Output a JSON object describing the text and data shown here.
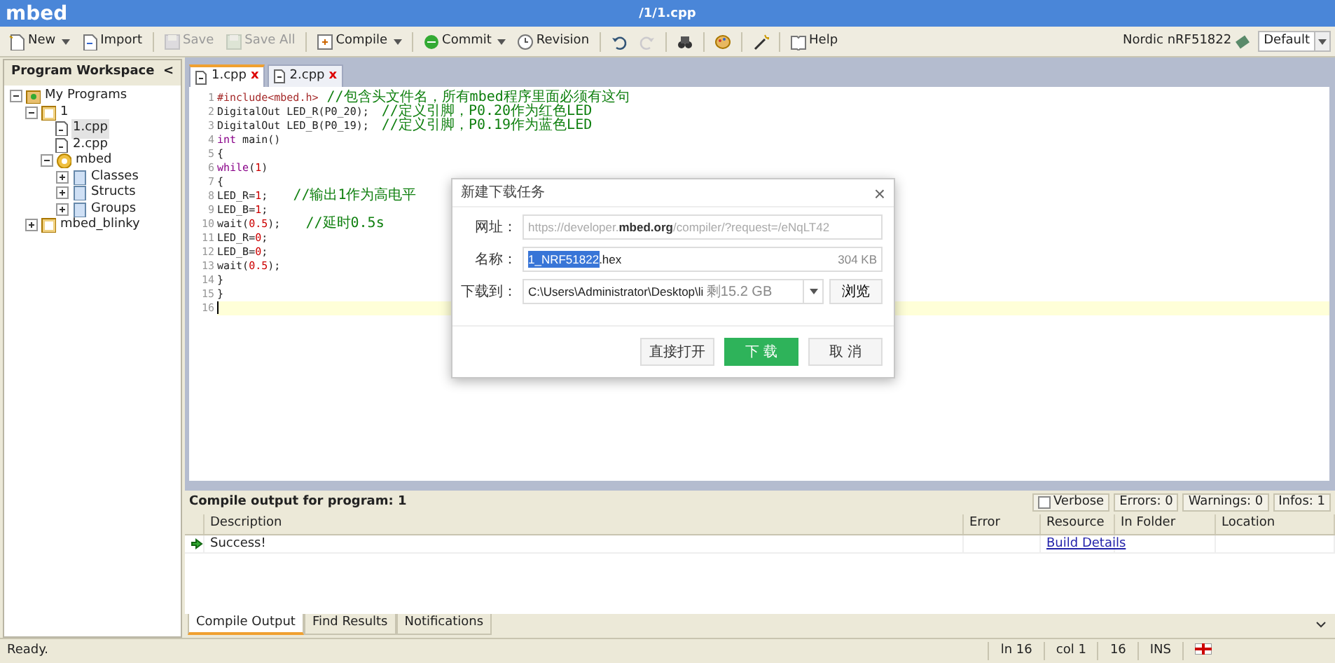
{
  "window": {
    "title": "mbed",
    "path": "/1/1.cpp"
  },
  "toolbar": [
    {
      "kind": "new",
      "label": "New",
      "dropdown": true,
      "disabled": false
    },
    {
      "kind": "import",
      "label": "Import",
      "dropdown": false,
      "disabled": false
    },
    {
      "kind": "save",
      "label": "Save",
      "dropdown": false,
      "disabled": true
    },
    {
      "kind": "saveall",
      "label": "Save All",
      "dropdown": false,
      "disabled": true
    },
    {
      "kind": "compile",
      "label": "Compile",
      "dropdown": true,
      "disabled": false
    },
    {
      "kind": "commit",
      "label": "Commit",
      "dropdown": true,
      "disabled": false
    },
    {
      "kind": "revision",
      "label": "Revision",
      "dropdown": false,
      "disabled": false
    },
    {
      "kind": "undo",
      "dropdown": false,
      "disabled": false
    },
    {
      "kind": "redo",
      "dropdown": false,
      "disabled": true
    },
    {
      "kind": "find",
      "dropdown": false,
      "disabled": false
    },
    {
      "kind": "palette",
      "dropdown": false,
      "disabled": false
    },
    {
      "kind": "wand",
      "dropdown": false,
      "disabled": false
    },
    {
      "kind": "help",
      "label": "Help",
      "dropdown": false,
      "disabled": false
    }
  ],
  "platform": {
    "label": "Nordic nRF51822",
    "theme": "Default"
  },
  "sidebar": {
    "title": "Program Workspace",
    "collapse": "<",
    "items": [
      {
        "label": "My Programs",
        "kind": "workspace",
        "expanded": true,
        "selected": false,
        "children": [
          {
            "label": "1",
            "kind": "program",
            "expanded": true,
            "selected": false,
            "children": [
              {
                "label": "1.cpp",
                "kind": "file",
                "selected": true
              },
              {
                "label": "2.cpp",
                "kind": "file",
                "selected": false
              },
              {
                "label": "mbed",
                "kind": "library",
                "expanded": true,
                "selected": false,
                "children": [
                  {
                    "label": "Classes",
                    "kind": "docs",
                    "expanded": false,
                    "selected": false
                  },
                  {
                    "label": "Structs",
                    "kind": "docs",
                    "expanded": false,
                    "selected": false
                  },
                  {
                    "label": "Groups",
                    "kind": "docs",
                    "expanded": false,
                    "selected": false
                  }
                ]
              }
            ]
          },
          {
            "label": "mbed_blinky",
            "kind": "program",
            "expanded": false,
            "selected": false
          }
        ]
      }
    ]
  },
  "tabs": [
    {
      "label": "1.cpp",
      "selected": true,
      "close": "x"
    },
    {
      "label": "2.cpp",
      "selected": false,
      "close": "x"
    }
  ],
  "code": [
    {
      "number": "1",
      "current": false,
      "segments": [
        {
          "kind": "pre",
          "text": "#include<mbed.h>"
        },
        {
          "kind": "comment",
          "text": " //包含头文件名，所有mbed程序里面必须有这句"
        }
      ]
    },
    {
      "number": "2",
      "current": false,
      "segments": [
        {
          "kind": "plain",
          "text": "DigitalOut LED_R(P0_20);  "
        },
        {
          "kind": "comment",
          "text": "//定义引脚，P0.20作为红色LED"
        }
      ]
    },
    {
      "number": "3",
      "current": false,
      "segments": [
        {
          "kind": "plain",
          "text": "DigitalOut LED_B(P0_19);  "
        },
        {
          "kind": "comment",
          "text": "//定义引脚，P0.19作为蓝色LED"
        }
      ]
    },
    {
      "number": "4",
      "current": false,
      "segments": [
        {
          "kind": "keyword",
          "text": "int"
        },
        {
          "kind": "plain",
          "text": " main()"
        }
      ]
    },
    {
      "number": "5",
      "current": false,
      "segments": [
        {
          "kind": "plain",
          "text": "{"
        }
      ]
    },
    {
      "number": "6",
      "current": false,
      "segments": [
        {
          "kind": "keyword",
          "text": "while"
        },
        {
          "kind": "plain",
          "text": "("
        },
        {
          "kind": "number",
          "text": "1"
        },
        {
          "kind": "plain",
          "text": ")"
        }
      ]
    },
    {
      "number": "7",
      "current": false,
      "segments": [
        {
          "kind": "plain",
          "text": "{"
        }
      ]
    },
    {
      "number": "8",
      "current": false,
      "segments": [
        {
          "kind": "plain",
          "text": "LED_R="
        },
        {
          "kind": "number",
          "text": "1"
        },
        {
          "kind": "plain",
          "text": ";    "
        },
        {
          "kind": "comment",
          "text": "//输出1作为高电平"
        }
      ]
    },
    {
      "number": "9",
      "current": false,
      "segments": [
        {
          "kind": "plain",
          "text": "LED_B="
        },
        {
          "kind": "number",
          "text": "1"
        },
        {
          "kind": "plain",
          "text": ";"
        }
      ]
    },
    {
      "number": "10",
      "current": false,
      "segments": [
        {
          "kind": "plain",
          "text": "wait("
        },
        {
          "kind": "number",
          "text": "0.5"
        },
        {
          "kind": "plain",
          "text": ");    "
        },
        {
          "kind": "comment",
          "text": "//延时0.5s"
        }
      ]
    },
    {
      "number": "11",
      "current": false,
      "segments": [
        {
          "kind": "plain",
          "text": "LED_R="
        },
        {
          "kind": "number",
          "text": "0"
        },
        {
          "kind": "plain",
          "text": ";"
        }
      ]
    },
    {
      "number": "12",
      "current": false,
      "segments": [
        {
          "kind": "plain",
          "text": "LED_B="
        },
        {
          "kind": "number",
          "text": "0"
        },
        {
          "kind": "plain",
          "text": ";"
        }
      ]
    },
    {
      "number": "13",
      "current": false,
      "segments": [
        {
          "kind": "plain",
          "text": "wait("
        },
        {
          "kind": "number",
          "text": "0.5"
        },
        {
          "kind": "plain",
          "text": ");"
        }
      ]
    },
    {
      "number": "14",
      "current": false,
      "segments": [
        {
          "kind": "plain",
          "text": "}"
        }
      ]
    },
    {
      "number": "15",
      "current": false,
      "segments": [
        {
          "kind": "plain",
          "text": "}"
        }
      ]
    },
    {
      "number": "16",
      "current": true
    }
  ],
  "dialog": {
    "title": "新建下载任务",
    "close": "×",
    "url_label": "网址：",
    "url": "https://developer.**mbed.org**/compiler/?request=/eNqLT42",
    "name_label": "名称：",
    "name_selected": "1_NRF51822",
    "name_rest": ".hex",
    "size": "304 KB",
    "dest_label": "下载到：",
    "dest": "C:\\Users\\Administrator\\Desktop\\li",
    "free": "剩15.2 GB",
    "browse": "浏览",
    "buttons": [
      {
        "label": "直接打开",
        "kind": "default"
      },
      {
        "label": "下 载",
        "kind": "primary"
      },
      {
        "label": "取 消",
        "kind": "default"
      }
    ]
  },
  "output": {
    "title": "Compile output for program: 1",
    "verbose": {
      "label": "Verbose",
      "checked": false
    },
    "counters": [
      "Errors: 0",
      "Warnings: 0",
      "Infos: 1"
    ],
    "columns": [
      "Description",
      "Error",
      "Resource",
      "In Folder",
      "Location"
    ],
    "rows": [
      {
        "kind": "success",
        "description": "Success!",
        "resource": "Build Details"
      }
    ],
    "tabs": [
      {
        "label": "Compile Output",
        "selected": true
      },
      {
        "label": "Find Results",
        "selected": false
      },
      {
        "label": "Notifications",
        "selected": false
      }
    ]
  },
  "status_bar": {
    "message": "Ready.",
    "line": "ln 16",
    "column": "col 1",
    "count": "16",
    "mode": "INS"
  }
}
